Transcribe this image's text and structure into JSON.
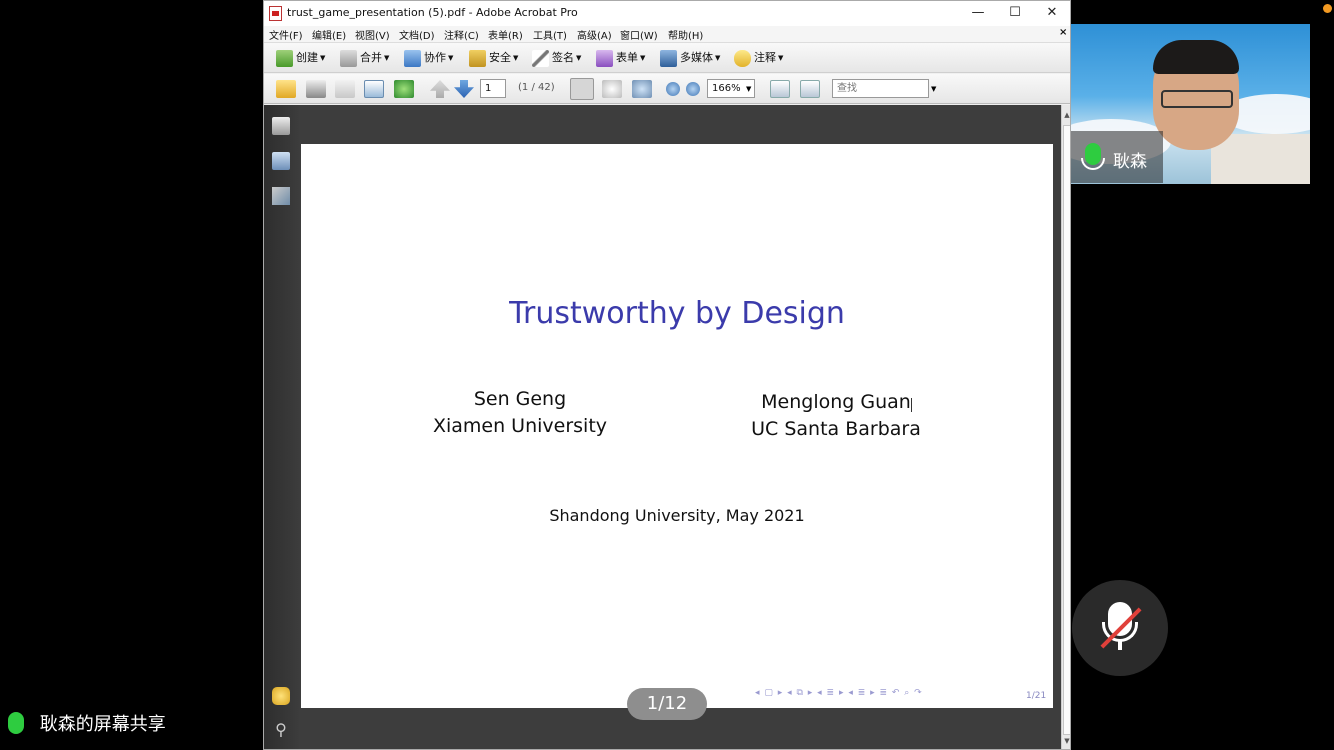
{
  "window": {
    "title": "trust_game_presentation (5).pdf - Adobe Acrobat Pro",
    "minimize": "—",
    "maximize": "☐",
    "close": "✕"
  },
  "menu": [
    "文件(F)",
    "编辑(E)",
    "视图(V)",
    "文档(D)",
    "注释(C)",
    "表单(R)",
    "工具(T)",
    "高级(A)",
    "窗口(W)",
    "帮助(H)"
  ],
  "menu_close": "×",
  "toolbar": {
    "create": "创建",
    "combine": "合并",
    "collaborate": "协作",
    "secure": "安全",
    "sign": "签名",
    "forms": "表单",
    "multimedia": "多媒体",
    "comment": "注释"
  },
  "nav": {
    "page_value": "1",
    "page_count": "(1 / 42)",
    "zoom": "166%",
    "search_placeholder": "查找"
  },
  "slide": {
    "title": "Trustworthy by Design",
    "author1_name": "Sen Geng",
    "author1_affil": "Xiamen University",
    "author2_name": "Menglong Guan",
    "author2_affil": "UC Santa Barbara",
    "venue": "Shandong University, May 2021",
    "page_indicator": "1/12",
    "nav_symbols": "◂ ▢ ▸  ◂ ⧉ ▸  ◂ ≣ ▸  ◂ ≣ ▸   ≣   ↶ ⌕ ↷",
    "slide_number": "1/21"
  },
  "video": {
    "participant_name": "耿森"
  },
  "share_status": "耿森的屏幕共享",
  "colors": {
    "slide_title": "#3b3bab",
    "status_dot": "#f39a22",
    "mic_green": "#2ecc40",
    "mic_muted_red": "#e0403a"
  }
}
